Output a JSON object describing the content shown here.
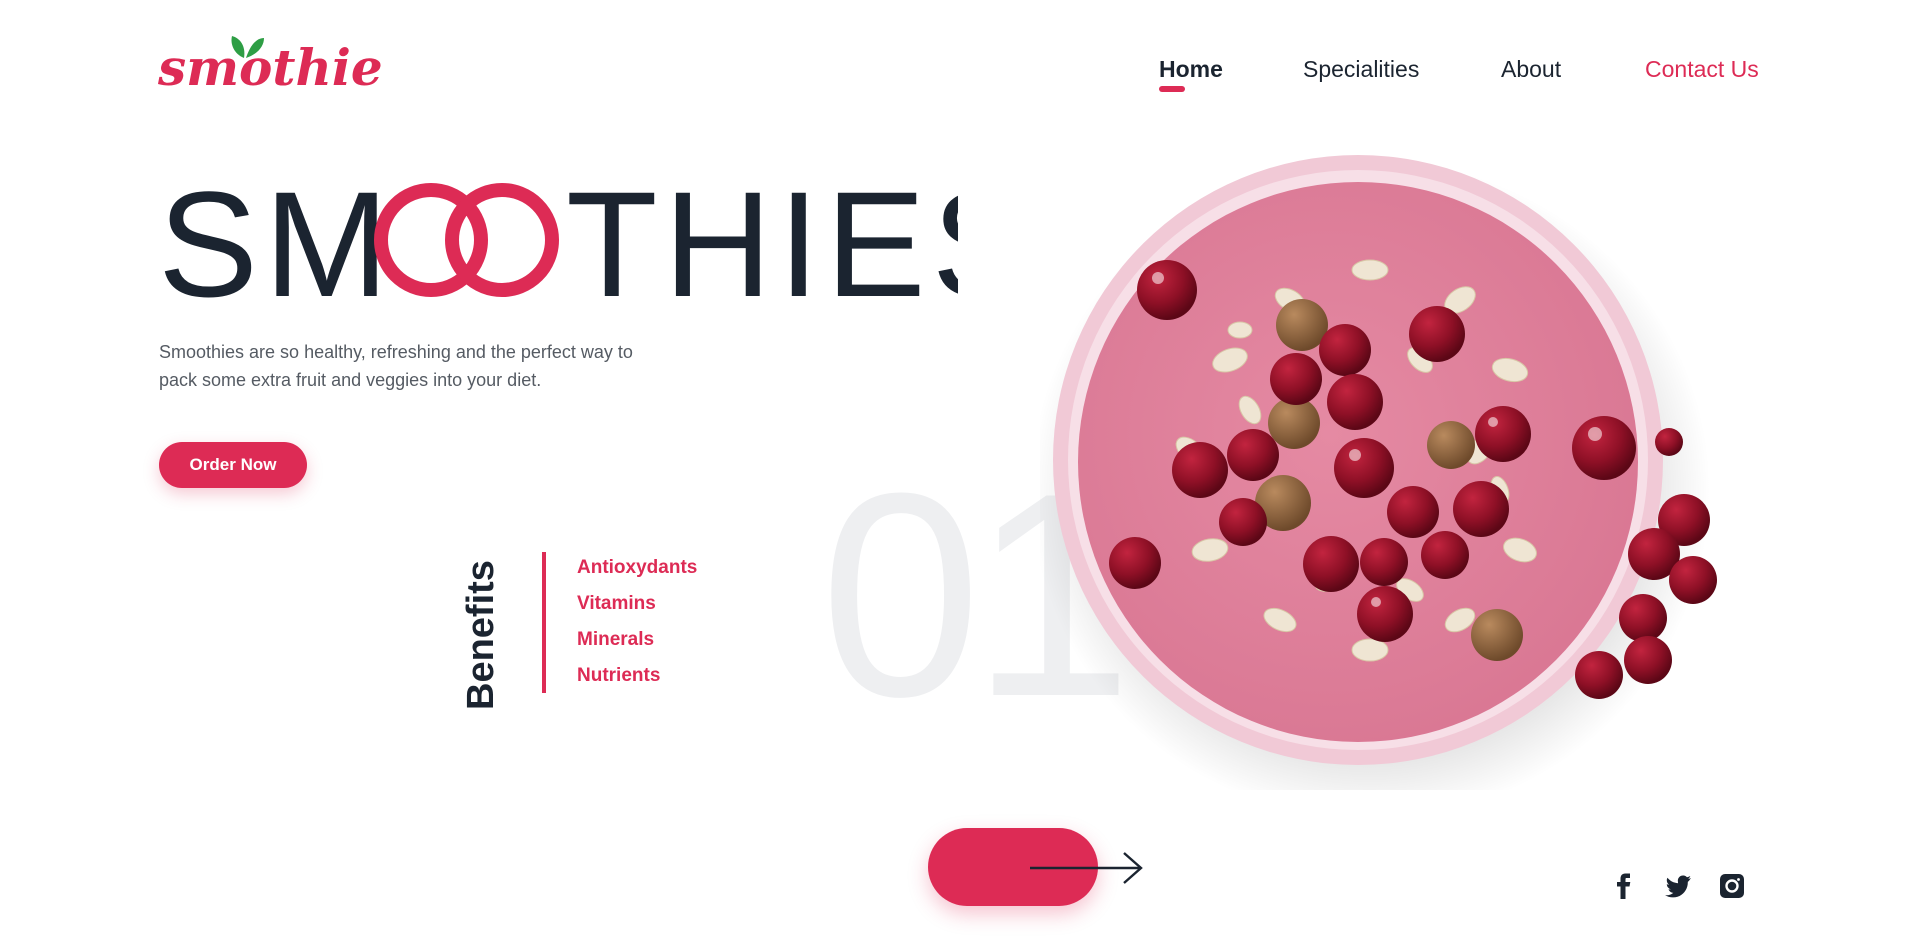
{
  "brand": {
    "logo_text": "smothie"
  },
  "nav": {
    "items": [
      {
        "label": "Home",
        "active": true
      },
      {
        "label": "Specialities"
      },
      {
        "label": "About"
      },
      {
        "label": "Contact Us"
      }
    ]
  },
  "hero": {
    "title_left": "SM",
    "title_right": "THIES",
    "description_line1": "Smoothies are so healthy, refreshing and the perfect way to",
    "description_line2": "pack some extra fruit and veggies into your diet.",
    "order_button": "Order Now"
  },
  "benefits": {
    "heading": "Benefits",
    "items": [
      "Antioxydants",
      "Vitamins",
      "Minerals",
      "Nutrients"
    ]
  },
  "slide_number": "01",
  "social": [
    "facebook-icon",
    "twitter-icon",
    "instagram-icon"
  ],
  "colors": {
    "accent": "#dd2b55",
    "text": "#1b2430",
    "leaf": "#2e9e45",
    "bowl_pink": "#e79ab0"
  }
}
